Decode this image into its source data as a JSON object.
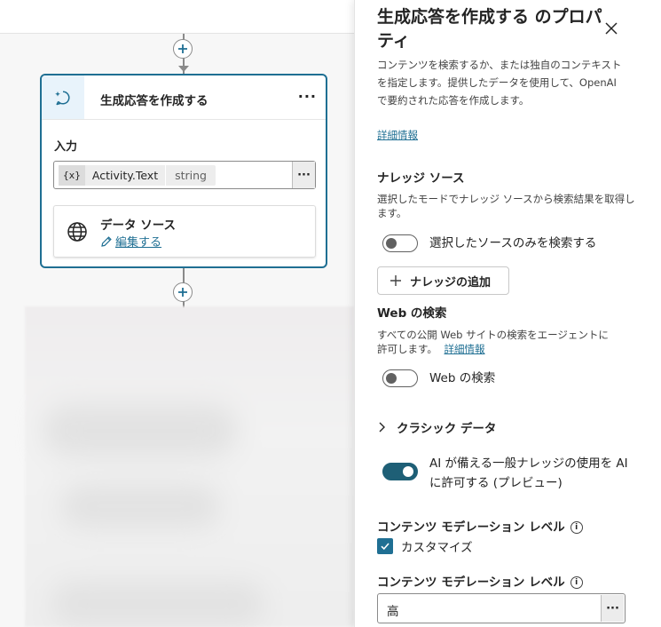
{
  "canvas": {
    "node": {
      "title": "生成応答を作成する",
      "more_label": "···",
      "input_label": "入力",
      "variable": {
        "icon_text": "{x}",
        "name": "Activity.Text",
        "type": "string"
      },
      "input_more_label": "···",
      "data_source": {
        "title": "データ ソース",
        "edit_label": "編集する"
      }
    }
  },
  "panel": {
    "title": "生成応答を作成する のプロパティ",
    "description": "コンテンツを検索するか、または独自のコンテキストを指定します。提供したデータを使用して、OpenAI で要約された応答を作成します。",
    "more_info": "詳細情報",
    "knowledge": {
      "heading": "ナレッジ ソース",
      "description": "選択したモードでナレッジ ソースから検索結果を取得します。",
      "toggle_label": "選択したソースのみを検索する",
      "toggle_on": false,
      "add_button": "ナレッジの追加"
    },
    "web": {
      "heading": "Web の検索",
      "description": "すべての公開 Web サイトの検索をエージェントに許可します。",
      "more_info": "詳細情報",
      "toggle_label": "Web の検索",
      "toggle_on": false
    },
    "classic": {
      "label": "クラシック データ"
    },
    "general_knowledge": {
      "toggle_label": "AI が備える一般ナレッジの使用を AI に許可する (プレビュー)",
      "toggle_on": true
    },
    "moderation": {
      "heading": "コンテンツ モデレーション レベル",
      "info_icon": "i",
      "customize_label": "カスタマイズ",
      "customize_checked": true,
      "select_heading": "コンテンツ モデレーション レベル",
      "select_value": "高",
      "select_more_label": "···"
    }
  },
  "colors": {
    "accent": "#1f6f93",
    "toggle_on": "#1e5f76",
    "node_icon_bg": "#e8f3fb"
  }
}
